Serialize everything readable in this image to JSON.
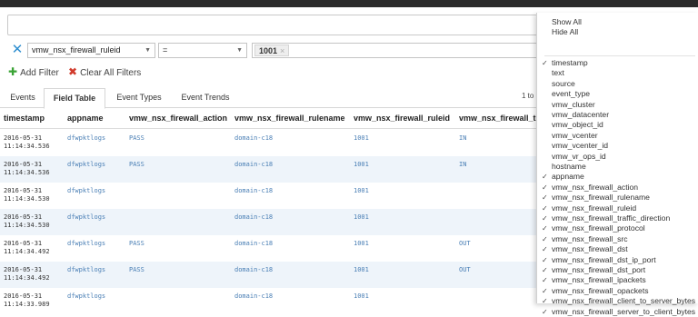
{
  "filter": {
    "field_value": "vmw_nsx_firewall_ruleid",
    "operator_value": "=",
    "value_chip": "1001",
    "add_filter_label": "Add Filter",
    "clear_filters_label": "Clear All Filters"
  },
  "tabs": [
    "Events",
    "Field Table",
    "Event Types",
    "Event Trends"
  ],
  "pager": {
    "text": "1 to"
  },
  "table": {
    "columns": [
      "timestamp",
      "appname",
      "vmw_nsx_firewall_action",
      "vmw_nsx_firewall_rulename",
      "vmw_nsx_firewall_ruleid",
      "vmw_nsx_firewall_tr"
    ],
    "rows": [
      {
        "date": "2016-05-31",
        "time": "11:14:34.536",
        "appname": "dfwpktlogs",
        "action": "PASS",
        "rulename": "domain-c18",
        "ruleid": "1001",
        "direction": "IN"
      },
      {
        "date": "2016-05-31",
        "time": "11:14:34.536",
        "appname": "dfwpktlogs",
        "action": "PASS",
        "rulename": "domain-c18",
        "ruleid": "1001",
        "direction": "IN"
      },
      {
        "date": "2016-05-31",
        "time": "11:14:34.530",
        "appname": "dfwpktlogs",
        "action": "",
        "rulename": "domain-c18",
        "ruleid": "1001",
        "direction": ""
      },
      {
        "date": "2016-05-31",
        "time": "11:14:34.530",
        "appname": "dfwpktlogs",
        "action": "",
        "rulename": "domain-c18",
        "ruleid": "1001",
        "direction": ""
      },
      {
        "date": "2016-05-31",
        "time": "11:14:34.492",
        "appname": "dfwpktlogs",
        "action": "PASS",
        "rulename": "domain-c18",
        "ruleid": "1001",
        "direction": "OUT"
      },
      {
        "date": "2016-05-31",
        "time": "11:14:34.492",
        "appname": "dfwpktlogs",
        "action": "PASS",
        "rulename": "domain-c18",
        "ruleid": "1001",
        "direction": "OUT"
      },
      {
        "date": "2016-05-31",
        "time": "11:14:33.989",
        "appname": "dfwpktlogs",
        "action": "",
        "rulename": "domain-c18",
        "ruleid": "1001",
        "direction": ""
      }
    ]
  },
  "column_menu": {
    "show_all": "Show All",
    "hide_all": "Hide All",
    "items": [
      {
        "label": "timestamp",
        "checked": true
      },
      {
        "label": "text",
        "checked": false
      },
      {
        "label": "source",
        "checked": false
      },
      {
        "label": "event_type",
        "checked": false
      },
      {
        "label": "vmw_cluster",
        "checked": false
      },
      {
        "label": "vmw_datacenter",
        "checked": false
      },
      {
        "label": "vmw_object_id",
        "checked": false
      },
      {
        "label": "vmw_vcenter",
        "checked": false
      },
      {
        "label": "vmw_vcenter_id",
        "checked": false
      },
      {
        "label": "vmw_vr_ops_id",
        "checked": false
      },
      {
        "label": "hostname",
        "checked": false
      },
      {
        "label": "appname",
        "checked": true
      },
      {
        "label": "vmw_nsx_firewall_action",
        "checked": true
      },
      {
        "label": "vmw_nsx_firewall_rulename",
        "checked": true
      },
      {
        "label": "vmw_nsx_firewall_ruleid",
        "checked": true
      },
      {
        "label": "vmw_nsx_firewall_traffic_direction",
        "checked": true
      },
      {
        "label": "vmw_nsx_firewall_protocol",
        "checked": true
      },
      {
        "label": "vmw_nsx_firewall_src",
        "checked": true
      },
      {
        "label": "vmw_nsx_firewall_dst",
        "checked": true
      },
      {
        "label": "vmw_nsx_firewall_dst_ip_port",
        "checked": true
      },
      {
        "label": "vmw_nsx_firewall_dst_port",
        "checked": true
      },
      {
        "label": "vmw_nsx_firewall_ipackets",
        "checked": true
      },
      {
        "label": "vmw_nsx_firewall_opackets",
        "checked": true
      },
      {
        "label": "vmw_nsx_firewall_client_to_server_bytes",
        "checked": true
      },
      {
        "label": "vmw_nsx_firewall_server_to_client_bytes",
        "checked": true
      }
    ]
  }
}
